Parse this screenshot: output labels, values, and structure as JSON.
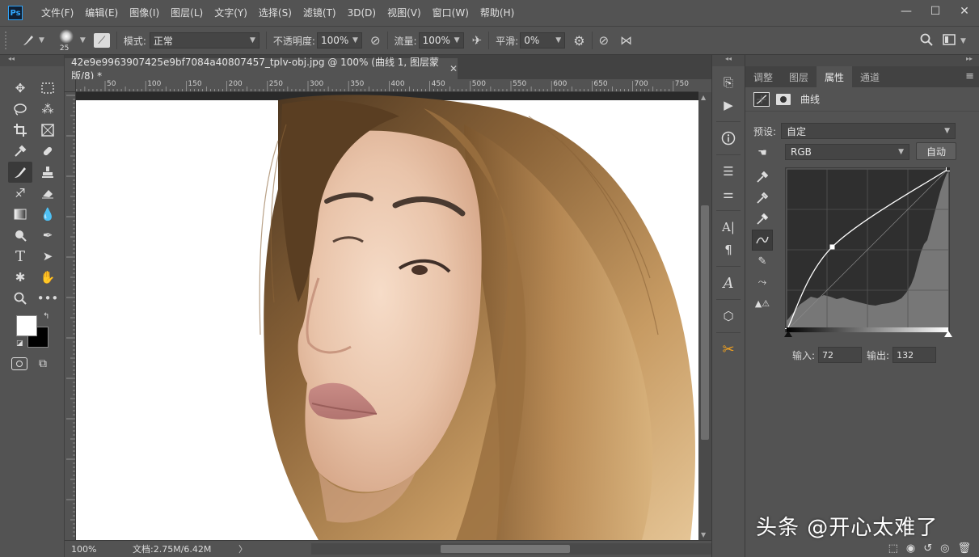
{
  "app": {
    "logo": "Ps",
    "menu": [
      "文件(F)",
      "编辑(E)",
      "图像(I)",
      "图层(L)",
      "文字(Y)",
      "选择(S)",
      "滤镜(T)",
      "3D(D)",
      "视图(V)",
      "窗口(W)",
      "帮助(H)"
    ],
    "window_controls": [
      "—",
      "☐",
      "✕"
    ]
  },
  "options": {
    "brush_size": "25",
    "mode_label": "模式:",
    "mode_value": "正常",
    "opacity_label": "不透明度:",
    "opacity_value": "100%",
    "flow_label": "流量:",
    "flow_value": "100%",
    "smooth_label": "平滑:",
    "smooth_value": "0%"
  },
  "document": {
    "tab_title": "42e9e9963907425e9bf7084a40807457_tplv-obj.jpg @ 100% (曲线 1, 图层蒙版/8) *",
    "tab_close": "✕",
    "ruler_ticks": [
      "50",
      "100",
      "150",
      "200",
      "250",
      "300",
      "350",
      "400",
      "450",
      "500",
      "550",
      "600",
      "650",
      "700",
      "750"
    ],
    "zoom": "100%",
    "doc_size": "文档:2.75M/6.42M",
    "status_arrow": "〉"
  },
  "panel": {
    "tabs": [
      "调整",
      "图层",
      "属性",
      "通道"
    ],
    "active_tab": 2,
    "menu_icon": "≡",
    "property_title": "曲线",
    "preset_label": "预设:",
    "preset_value": "自定",
    "channel_value": "RGB",
    "auto_label": "自动",
    "input_label": "输入:",
    "input_value": "72",
    "output_label": "输出:",
    "output_value": "132"
  },
  "curve": {
    "range": [
      0,
      255
    ],
    "points": [
      [
        0,
        0
      ],
      [
        72,
        132
      ],
      [
        255,
        255
      ]
    ]
  },
  "watermark": "头条 @开心太难了",
  "colors": {
    "ui_bg": "#535353",
    "fg_color": "#ffffff",
    "bg_color": "#000000",
    "accent": "#31a8ff"
  }
}
